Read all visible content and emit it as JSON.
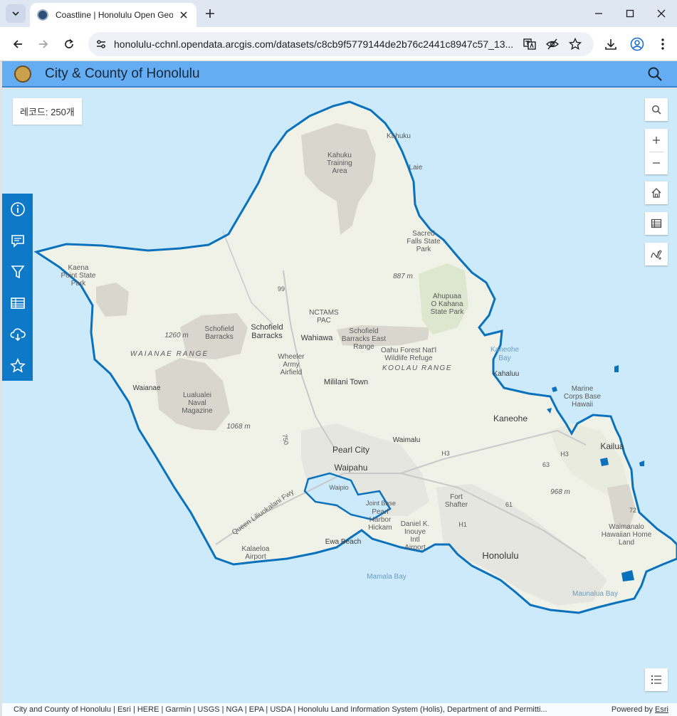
{
  "browser": {
    "tab_title": "Coastline | Honolulu Open Geo",
    "url": "honolulu-cchnl.opendata.arcgis.com/datasets/c8cb9f5779144de2b76c2441c8947c57_13..."
  },
  "app": {
    "title": "City & County of Honolulu"
  },
  "map": {
    "record_count": "레코드: 250개",
    "labels": {
      "kahuku": "Kahuku",
      "laie": "Laie",
      "kahuku_area_1": "Kahuku",
      "kahuku_area_2": "Training",
      "kahuku_area_3": "Area",
      "sacred_1": "Sacred",
      "sacred_2": "Falls State",
      "sacred_3": "Park",
      "elev_887": "887 m",
      "kaena_1": "Kaena",
      "kaena_2": "Point State",
      "kaena_3": "Park",
      "route_99": "99",
      "ahupuaa_1": "Ahupuaa",
      "ahupuaa_2": "O Kahana",
      "ahupuaa_3": "State Park",
      "nctams_1": "NCTAMS",
      "nctams_2": "PAC",
      "schofield_b1": "Schofield",
      "schofield_b2": "Barracks",
      "schofield_town_1": "Schofield",
      "schofield_town_2": "Barracks",
      "elev_1260": "1260 m",
      "wahiawa": "Wahiawa",
      "schofield_east_1": "Schofield",
      "schofield_east_2": "Barracks East",
      "schofield_east_3": "Range",
      "kaneohe_bay_1": "Kaneohe",
      "kaneohe_bay_2": "Bay",
      "waianae_range": "WAIANAE RANGE",
      "wheeler_1": "Wheeler",
      "wheeler_2": "Army",
      "wheeler_3": "Airfield",
      "oahu_forest_1": "Oahu Forest Nat'l",
      "oahu_forest_2": "Wildlife Refuge",
      "koolau_range": "KOOLAU RANGE",
      "kahaluu": "Kahaluu",
      "mililani": "Mililani Town",
      "waianae": "Waianae",
      "lualualei_1": "Lualualei",
      "lualualei_2": "Naval",
      "lualualei_3": "Magazine",
      "marine_1": "Marine",
      "marine_2": "Corps Base",
      "marine_3": "Hawaii",
      "kaneohe": "Kaneohe",
      "elev_1068": "1068 m",
      "route_750": "750",
      "waimalu": "Waimalu",
      "pearl_city": "Pearl City",
      "kailua": "Kailua",
      "route_h3": "H3",
      "waipahu": "Waipahu",
      "waipio": "Waipio",
      "route_63": "63",
      "route_h3b": "H3",
      "fort_shafter_1": "Fort",
      "fort_shafter_2": "Shafter",
      "elev_968": "968 m",
      "freeway": "Queen Liliuokalani Fwy",
      "joint_base": "Joint Base",
      "pearl_1": "Pearl",
      "pearl_2": "Harbor",
      "pearl_3": "Hickam",
      "route_61": "61",
      "route_72": "72",
      "inouye_1": "Daniel K.",
      "inouye_2": "Inouye",
      "inouye_3": "Intl",
      "inouye_4": "Airport",
      "route_h1": "H1",
      "waimanalo_1": "Waimanalo",
      "waimanalo_2": "Hawaiian Home",
      "waimanalo_3": "Land",
      "ewa_beach": "Ewa Beach",
      "kalaeloa_1": "Kalaeloa",
      "kalaeloa_2": "Airport",
      "honolulu": "Honolulu",
      "mamala_bay": "Mamala Bay",
      "maunalua_bay": "Maunalua Bay"
    }
  },
  "attribution": {
    "text": "City and County of Honolulu | Esri | HERE | Garmin | USGS | NGA | EPA | USDA | Honolulu Land Information System (Holis), Department of and Permitti...",
    "powered_by": "Powered by ",
    "esri": "Esri"
  },
  "colors": {
    "water": "#cdeafa",
    "land": "#f1f2e7",
    "coastline": "#0a71bd",
    "header": "#64adf3",
    "side_panel": "#0d79c7"
  }
}
